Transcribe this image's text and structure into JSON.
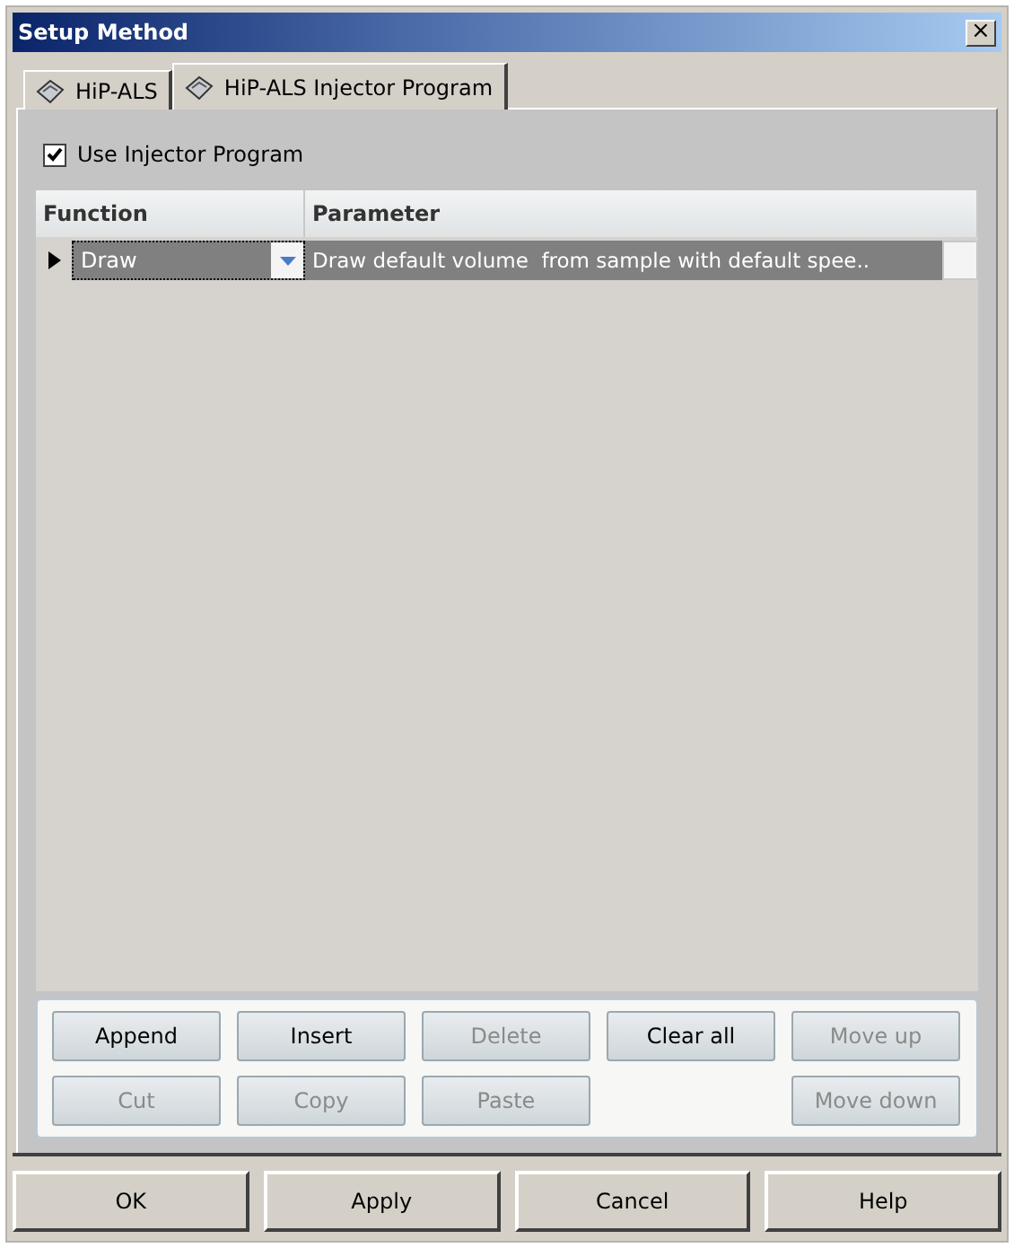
{
  "window": {
    "title": "Setup Method",
    "close": "×"
  },
  "tabs": [
    {
      "label": "HiP-ALS",
      "selected": false
    },
    {
      "label": "HiP-ALS Injector Program",
      "selected": true
    }
  ],
  "use_injector_program": {
    "label": "Use Injector Program",
    "checked": true
  },
  "table": {
    "columns": [
      "Function",
      "Parameter"
    ],
    "rows": [
      {
        "function": "Draw",
        "parameter": "Draw default volume  from sample with default spee..",
        "selected": true
      }
    ]
  },
  "program_buttons": [
    {
      "label": "Append",
      "disabled": false
    },
    {
      "label": "Insert",
      "disabled": false
    },
    {
      "label": "Delete",
      "disabled": true
    },
    {
      "label": "Clear all",
      "disabled": false
    },
    {
      "label": "Move up",
      "disabled": true
    },
    {
      "label": "Cut",
      "disabled": true
    },
    {
      "label": "Copy",
      "disabled": true
    },
    {
      "label": "Paste",
      "disabled": true
    },
    {
      "label": "Move down",
      "disabled": true
    }
  ],
  "dialog_buttons": [
    "OK",
    "Apply",
    "Cancel",
    "Help"
  ]
}
